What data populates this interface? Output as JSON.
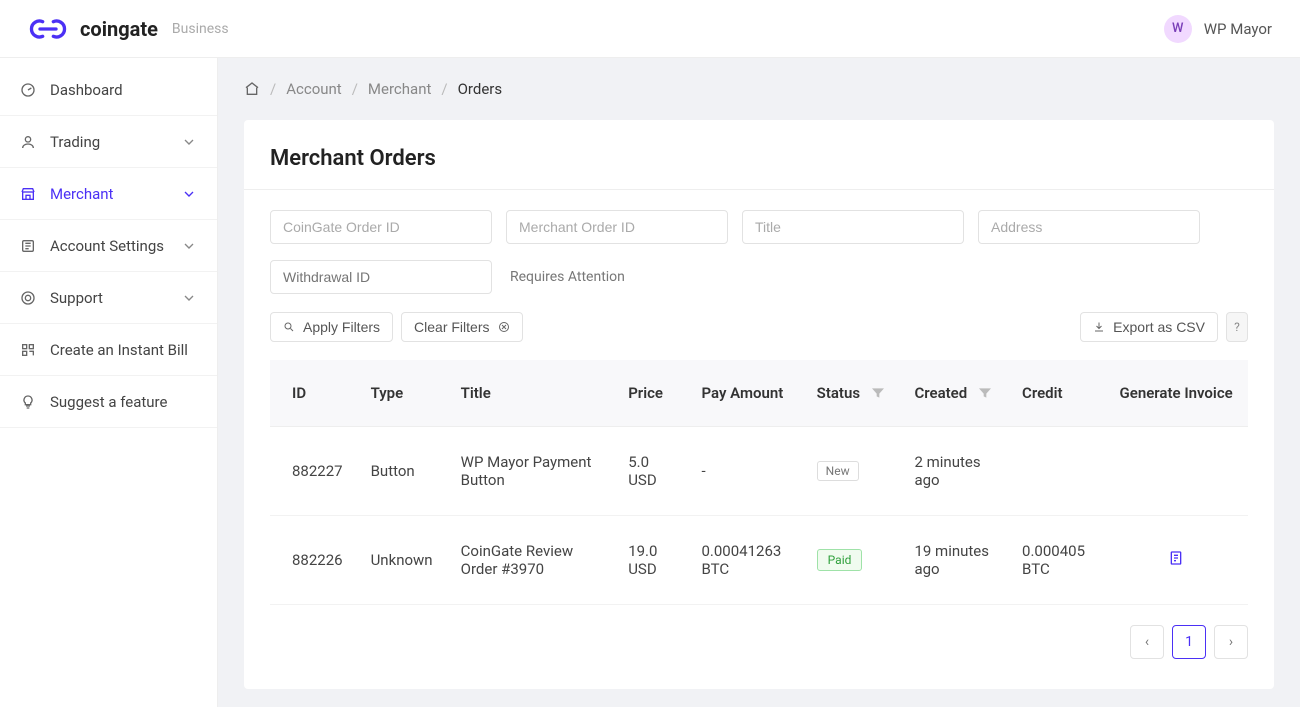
{
  "header": {
    "brand_name": "coingate",
    "brand_tag": "Business",
    "user_initial": "W",
    "user_name": "WP Mayor"
  },
  "sidebar": {
    "items": [
      {
        "label": "Dashboard",
        "icon": "gauge",
        "expandable": false,
        "active": false
      },
      {
        "label": "Trading",
        "icon": "person",
        "expandable": true,
        "active": false
      },
      {
        "label": "Merchant",
        "icon": "storefront",
        "expandable": true,
        "active": true
      },
      {
        "label": "Account Settings",
        "icon": "settings",
        "expandable": true,
        "active": false
      },
      {
        "label": "Support",
        "icon": "lifebuoy",
        "expandable": true,
        "active": false
      },
      {
        "label": "Create an Instant Bill",
        "icon": "qr",
        "expandable": false,
        "active": false
      },
      {
        "label": "Suggest a feature",
        "icon": "bulb",
        "expandable": false,
        "active": false
      }
    ]
  },
  "breadcrumb": {
    "items": [
      "Account",
      "Merchant"
    ],
    "current": "Orders"
  },
  "page": {
    "title": "Merchant Orders"
  },
  "filters": {
    "placeholders": {
      "coingate_order_id": "CoinGate Order ID",
      "merchant_order_id": "Merchant Order ID",
      "title": "Title",
      "address": "Address",
      "withdrawal_id": "Withdrawal ID"
    },
    "requires_attention_label": "Requires Attention",
    "apply_label": "Apply Filters",
    "clear_label": "Clear Filters",
    "export_label": "Export as CSV",
    "hint_label": "?"
  },
  "table": {
    "headers": {
      "id": "ID",
      "type": "Type",
      "title": "Title",
      "price": "Price",
      "pay_amount": "Pay Amount",
      "status": "Status",
      "created": "Created",
      "credit": "Credit",
      "generate_invoice": "Generate Invoice"
    },
    "rows": [
      {
        "id": "882227",
        "type": "Button",
        "type_is_link": true,
        "title": "WP Mayor Payment Button",
        "price": "5.0 USD",
        "pay_amount": "-",
        "status": "New",
        "status_kind": "new",
        "created": "2 minutes ago",
        "credit": "",
        "invoice": false
      },
      {
        "id": "882226",
        "type": "Unknown",
        "type_is_link": false,
        "title": "CoinGate Review Order #3970",
        "price": "19.0 USD",
        "pay_amount": "0.00041263 BTC",
        "status": "Paid",
        "status_kind": "paid",
        "created": "19 minutes ago",
        "credit": "0.000405 BTC",
        "invoice": true
      }
    ]
  },
  "pagination": {
    "prev": "‹",
    "current": "1",
    "next": "›"
  }
}
